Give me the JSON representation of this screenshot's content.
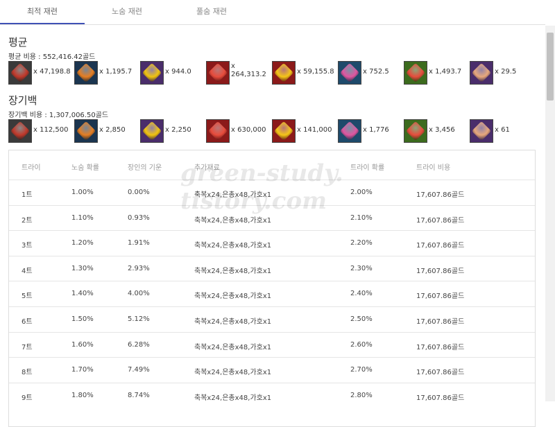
{
  "tabs": [
    {
      "label": "최적 재련"
    },
    {
      "label": "노숨 재련"
    },
    {
      "label": "풀숨 재련"
    }
  ],
  "average": {
    "title": "평균",
    "cost": "평균 비용 : 552,416.42골드",
    "items": [
      {
        "icon": "destruction-stone-icon",
        "color": "#c0392b",
        "bg": "#3a3a3a",
        "qty": "x 47,198.8"
      },
      {
        "icon": "guardian-stone-icon",
        "color": "#e67e22",
        "bg": "#1b3550",
        "qty": "x 1,195.7"
      },
      {
        "icon": "leapstone-icon",
        "color": "#f1c40f",
        "bg": "#4a2d6b",
        "qty": "x 944.0"
      },
      {
        "icon": "shard-pouch-icon",
        "color": "#e74c3c",
        "bg": "#8b1a1a",
        "qty": "x 264,313.2"
      },
      {
        "icon": "gold-coin-icon",
        "color": "#f5c518",
        "bg": "#8b1a1a",
        "qty": "x 59,155.8"
      },
      {
        "icon": "fusion-material-icon",
        "color": "#e056a0",
        "bg": "#1e4a6b",
        "qty": "x 752.5"
      },
      {
        "icon": "solar-grace-icon",
        "color": "#e74c3c",
        "bg": "#3c6b1e",
        "qty": "x 1,493.7"
      },
      {
        "icon": "solar-blessing-icon",
        "color": "#e8a87c",
        "bg": "#4a2d6b",
        "qty": "x 29.5"
      }
    ]
  },
  "artisan": {
    "title": "장기백",
    "cost": "장기백 비용 : 1,307,006.50골드",
    "items": [
      {
        "icon": "destruction-stone-icon",
        "color": "#c0392b",
        "bg": "#3a3a3a",
        "qty": "x 112,500"
      },
      {
        "icon": "guardian-stone-icon",
        "color": "#e67e22",
        "bg": "#1b3550",
        "qty": "x 2,850"
      },
      {
        "icon": "leapstone-icon",
        "color": "#f1c40f",
        "bg": "#4a2d6b",
        "qty": "x 2,250"
      },
      {
        "icon": "shard-pouch-icon",
        "color": "#e74c3c",
        "bg": "#8b1a1a",
        "qty": "x 630,000"
      },
      {
        "icon": "gold-coin-icon",
        "color": "#f5c518",
        "bg": "#8b1a1a",
        "qty": "x 141,000"
      },
      {
        "icon": "fusion-material-icon",
        "color": "#e056a0",
        "bg": "#1e4a6b",
        "qty": "x 1,776"
      },
      {
        "icon": "solar-grace-icon",
        "color": "#e74c3c",
        "bg": "#3c6b1e",
        "qty": "x 3,456"
      },
      {
        "icon": "solar-blessing-icon",
        "color": "#e8a87c",
        "bg": "#4a2d6b",
        "qty": "x 61"
      }
    ]
  },
  "table": {
    "headers": [
      "트라이",
      "노숨 확률",
      "장인의 기운",
      "추가재료",
      "트라이 확률",
      "트라이 비용"
    ],
    "rows": [
      [
        "1트",
        "1.00%",
        "0.00%",
        "축복x24,은총x48,가호x1",
        "2.00%",
        "17,607.86골드"
      ],
      [
        "2트",
        "1.10%",
        "0.93%",
        "축복x24,은총x48,가호x1",
        "2.10%",
        "17,607.86골드"
      ],
      [
        "3트",
        "1.20%",
        "1.91%",
        "축복x24,은총x48,가호x1",
        "2.20%",
        "17,607.86골드"
      ],
      [
        "4트",
        "1.30%",
        "2.93%",
        "축복x24,은총x48,가호x1",
        "2.30%",
        "17,607.86골드"
      ],
      [
        "5트",
        "1.40%",
        "4.00%",
        "축복x24,은총x48,가호x1",
        "2.40%",
        "17,607.86골드"
      ],
      [
        "6트",
        "1.50%",
        "5.12%",
        "축복x24,은총x48,가호x1",
        "2.50%",
        "17,607.86골드"
      ],
      [
        "7트",
        "1.60%",
        "6.28%",
        "축복x24,은총x48,가호x1",
        "2.60%",
        "17,607.86골드"
      ],
      [
        "8트",
        "1.70%",
        "7.49%",
        "축복x24,은총x48,가호x1",
        "2.70%",
        "17,607.86골드"
      ],
      [
        "9트",
        "1.80%",
        "8.74%",
        "축복x24,은총x48,가호x1",
        "2.80%",
        "17,607.86골드"
      ]
    ]
  },
  "watermark": [
    "green-study.",
    "tistory.com"
  ]
}
